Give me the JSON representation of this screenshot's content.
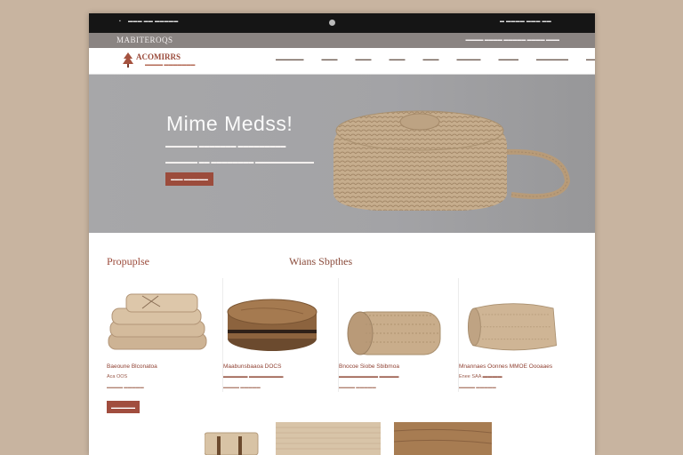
{
  "topbar": {
    "left_a": "▪",
    "left_b": "▬▬▬ ▬▬",
    "left_c": "▬▬▬▬▬",
    "right": "▬ ▬▬▬▬ ▬▬▬ ▬▬"
  },
  "site": {
    "title": "MABITEROQS",
    "links": "▬▬▬▬ ▬▬▬▬ ▬▬▬▬▬ ▬▬▬▬ ▬▬▬"
  },
  "brand": {
    "name": "ACOMIRRS",
    "tagline": "▬▬▬▬ ▬▬▬▬▬▬▬"
  },
  "menu": [
    "▬▬▬▬▬▬▬",
    "▬▬▬▬",
    "▬▬▬▬",
    "▬▬▬▬",
    "▬▬▬▬",
    "▬▬▬▬▬▬",
    "▬▬▬▬▬",
    "▬▬▬▬▬▬▬▬",
    "▬▬▬▬▬"
  ],
  "hero": {
    "title": "Mime Medss!",
    "line1": "▬▬▬▬▬▬ ▬▬▬▬▬▬▬ ▬▬▬▬▬▬▬▬▬",
    "line2": "▬▬▬▬▬▬ ▬▬ ▬▬▬▬▬▬▬▬ ▬▬▬▬▬▬▬▬▬▬▬",
    "button": "▬▬▬ ▬▬▬▬▬▬"
  },
  "sections": {
    "left": "Propuplse",
    "right": "Wians Sbpthes"
  },
  "cards": [
    {
      "name": "Baeoune Blconatoa",
      "price": "Aca OOS",
      "meta": "▬▬▬▬ ▬▬▬▬▬"
    },
    {
      "name": "Maabunsbaaoa DOCS",
      "price": "▬▬▬▬▬ ▬▬▬▬▬▬▬",
      "meta": "▬▬▬▬ ▬▬▬▬▬"
    },
    {
      "name": "Bnocoe Siobe Sbibmoa",
      "price": "▬▬▬▬▬▬▬▬ ▬▬▬▬",
      "meta": "▬▬▬▬ ▬▬▬▬▬"
    },
    {
      "name": "Mnannaes Oonnes MMOE Oooaaes",
      "price": "Enee SAA ▬▬▬▬",
      "meta": "▬▬▬▬ ▬▬▬▬▬"
    }
  ],
  "shop_button": "▬▬▬▬▬▬",
  "colors": {
    "accent": "#9c4c3c",
    "topbar": "#151515",
    "hero_bg": "#a6a6a8",
    "burlap": "#c7ad8c"
  }
}
